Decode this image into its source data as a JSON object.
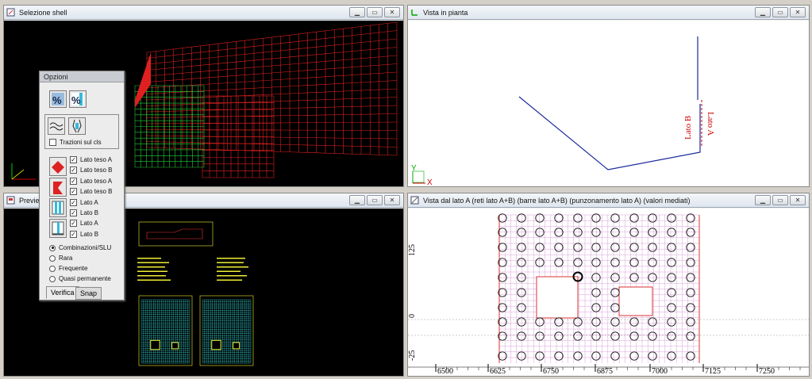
{
  "windows": {
    "shell": {
      "title": "Selezione shell"
    },
    "plan": {
      "title": "Vista in pianta",
      "side_a": "Lato A",
      "side_b": "Lato B",
      "axis_x": "X",
      "axis_y": "Y"
    },
    "preview": {
      "title": "Previe"
    },
    "side_view": {
      "title": "Vista dal lato A (reti lato A+B) (barre lato A+B) (punzonamento lato A) (valori mediati)",
      "ruler_labels": [
        "6500",
        "6625",
        "6750",
        "6875",
        "7000",
        "7125",
        "7250"
      ],
      "left_labels": [
        "125",
        "0",
        "-25"
      ]
    }
  },
  "options": {
    "title": "Opzioni",
    "tractions_label": "Trazioni sul cls",
    "checks": [
      {
        "label": "Lato teso A",
        "checked": true
      },
      {
        "label": "Lato teso B",
        "checked": true
      },
      {
        "label": "Lato teso A",
        "checked": true
      },
      {
        "label": "Lato teso B",
        "checked": true
      },
      {
        "label": "Lato A",
        "checked": true
      },
      {
        "label": "Lato B",
        "checked": true
      },
      {
        "label": "Lato A",
        "checked": true
      },
      {
        "label": "Lato B",
        "checked": true
      }
    ],
    "radios": [
      {
        "label": "Combinazioni/SLU",
        "selected": true
      },
      {
        "label": "Rara",
        "selected": false
      },
      {
        "label": "Frequente",
        "selected": false
      },
      {
        "label": "Quasi permanente",
        "selected": false
      }
    ],
    "tabs": [
      "Verifica",
      "Snap"
    ]
  },
  "window_controls": {
    "minimize": "▁",
    "restore": "▭",
    "close": "✕"
  }
}
